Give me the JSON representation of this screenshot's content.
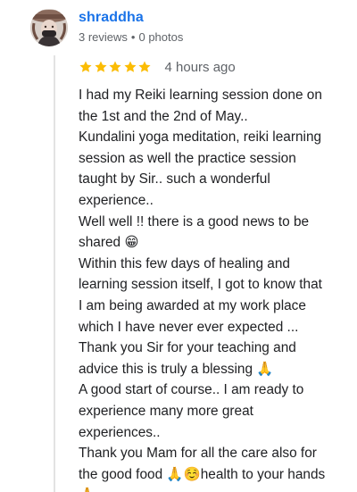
{
  "reviewer": {
    "name": "shraddha",
    "reviews": "3 reviews",
    "separator": "•",
    "photos": "0 photos",
    "avatar_icon": "profile-photo"
  },
  "rating": {
    "stars": 5,
    "max_stars": 5,
    "star_color": "#fbbc04",
    "time": "4 hours ago"
  },
  "review": {
    "lines": [
      "I had my Reiki learning session done on",
      "the 1st and the 2nd of May..",
      "Kundalini yoga meditation, reiki learning",
      "session as well the practice session",
      "taught by Sir.. such a wonderful",
      "experience..",
      "Well well !! there is a good news to be",
      "shared 😁",
      "Within this few days of healing and",
      "learning session itself, I got to know that",
      "I am being awarded at my work place",
      "which I have never ever expected ...",
      "Thank you Sir for your teaching and",
      "advice this is truly a blessing 🙏",
      "A good start of course.. I am ready to",
      "experience many more great",
      "experiences..",
      "Thank you Mam for all the care also for",
      "the good food 🙏☺️health to your hands",
      "🙏"
    ]
  },
  "colors": {
    "name_blue": "#1a73e8",
    "meta_gray": "#5f6368",
    "text": "#202124"
  }
}
